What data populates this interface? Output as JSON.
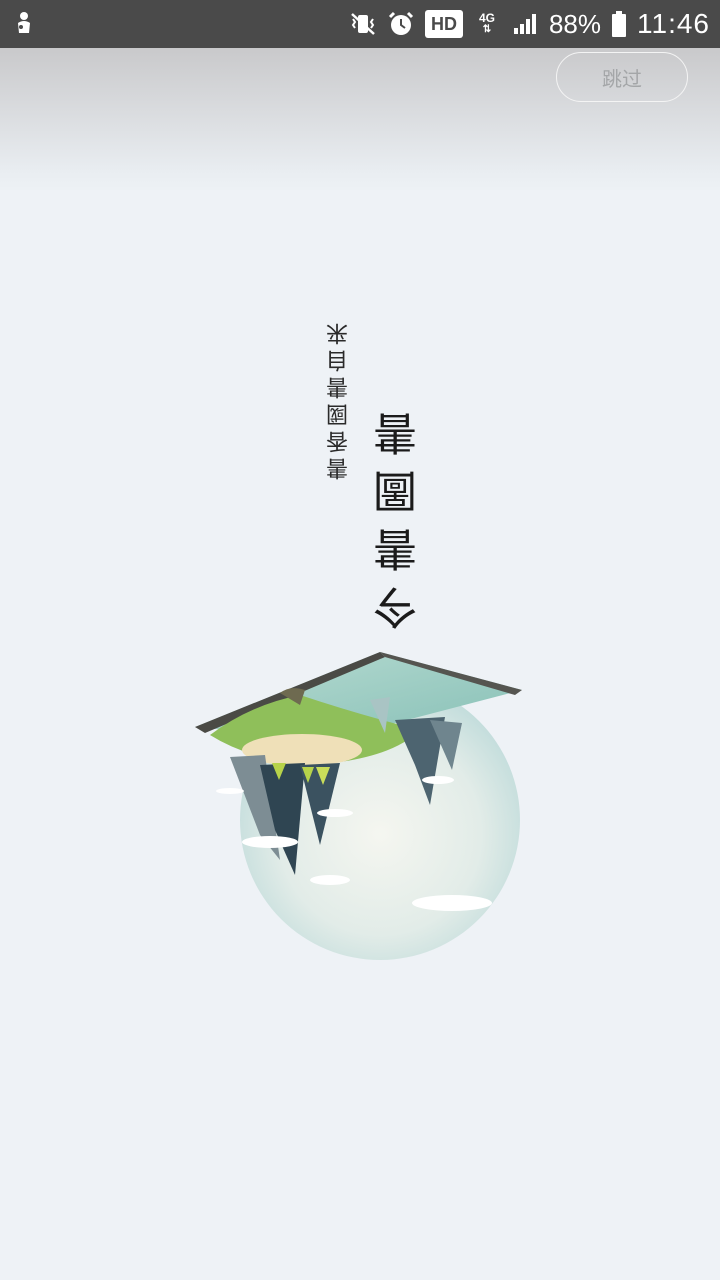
{
  "status_bar": {
    "network_type": "4G",
    "hd_label": "HD",
    "battery_percent": "88%",
    "time": "11:46",
    "icons": [
      "notification-app-icon",
      "mute-vibrate-icon",
      "alarm-icon",
      "hd-icon",
      "data-arrows-icon",
      "signal-icon",
      "battery-icon"
    ]
  },
  "splash": {
    "skip_label": "跳过",
    "title": "今書圖書",
    "subtitle": "書香國書自来"
  },
  "colors": {
    "statusbar_bg": "#4a4a4a",
    "page_bg": "#eef2f6",
    "skip_text": "#a4a6a8"
  }
}
